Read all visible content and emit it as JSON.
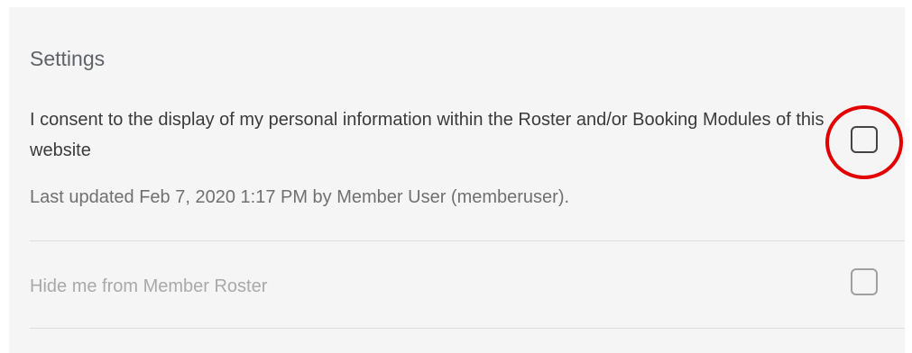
{
  "settings": {
    "title": "Settings",
    "consent": {
      "label": "I consent to the display of my personal information within the Roster and/or Booking Modules of this website",
      "checked": false,
      "last_updated": "Last updated Feb 7, 2020 1:17 PM by Member User (memberuser)."
    },
    "hide_roster": {
      "label": "Hide me from Member Roster",
      "checked": false,
      "disabled": true
    }
  },
  "colors": {
    "panel_background": "#f5f5f5",
    "highlight_ring": "#e30000",
    "disabled_text": "#a9a9a9"
  }
}
